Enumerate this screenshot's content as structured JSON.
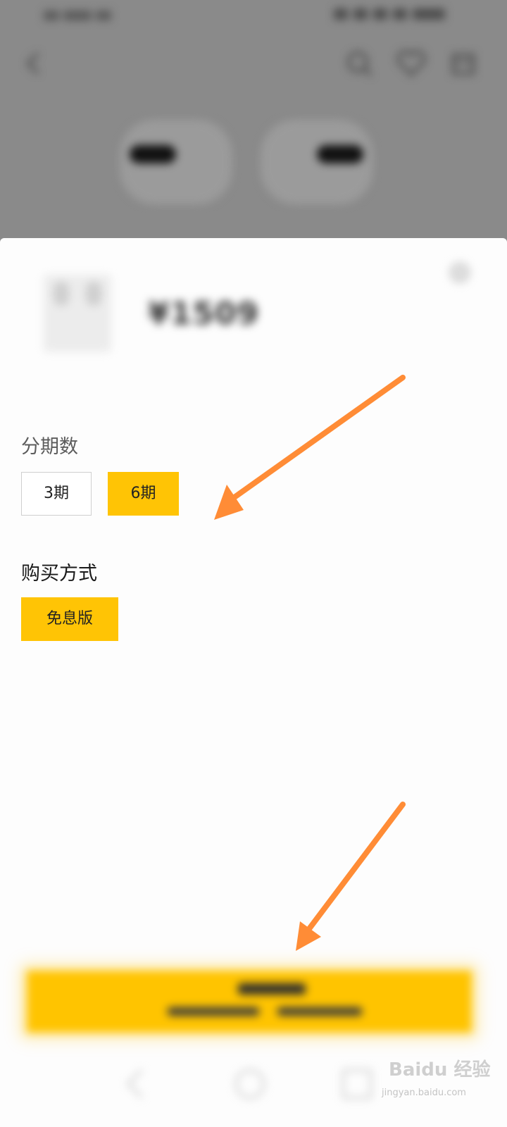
{
  "price": "¥1509",
  "installments": {
    "label": "分期数",
    "options": [
      {
        "label": "3期",
        "selected": false
      },
      {
        "label": "6期",
        "selected": true
      }
    ]
  },
  "purchase_method": {
    "label": "购买方式",
    "options": [
      {
        "label": "免息版",
        "selected": true
      }
    ]
  },
  "close_icon": "×",
  "watermark": {
    "brand": "Baidu 经验",
    "url": "jingyan.baidu.com"
  },
  "colors": {
    "accent": "#ffc405",
    "arrow": "#ff8c36",
    "overlay": "#8a8a8a"
  }
}
